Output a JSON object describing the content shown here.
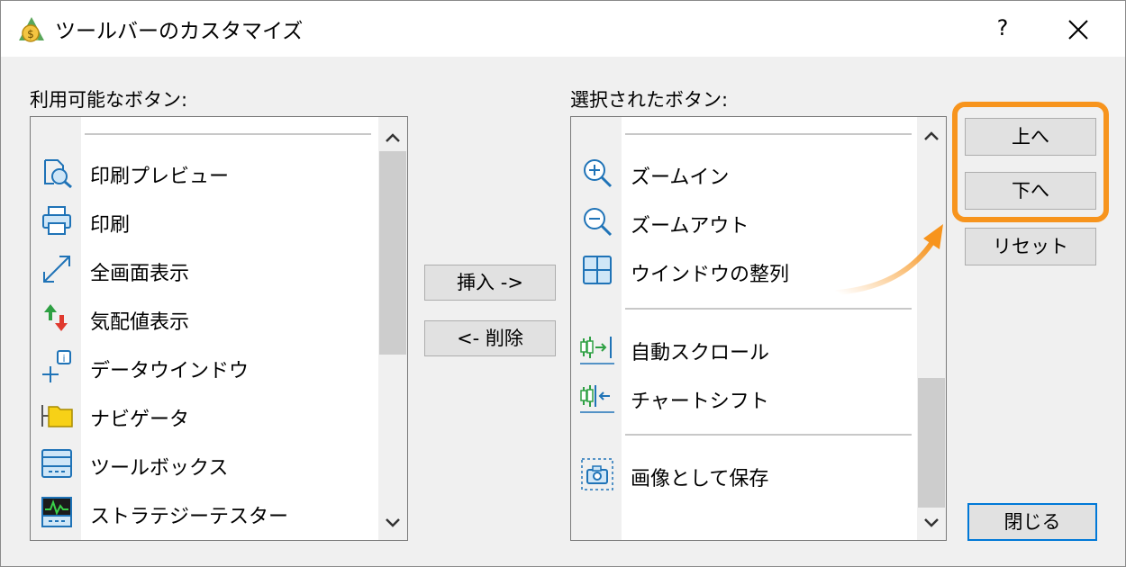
{
  "window": {
    "title": "ツールバーのカスタマイズ",
    "help_label": "?",
    "close_icon": "close-icon"
  },
  "available": {
    "label": "利用可能なボタン:",
    "items": [
      {
        "label": "印刷プレビュー",
        "icon": "print-preview-icon"
      },
      {
        "label": "印刷",
        "icon": "printer-icon"
      },
      {
        "label": "全画面表示",
        "icon": "fullscreen-icon"
      },
      {
        "label": "気配値表示",
        "icon": "market-watch-icon"
      },
      {
        "label": "データウインドウ",
        "icon": "data-window-icon"
      },
      {
        "label": "ナビゲータ",
        "icon": "navigator-icon"
      },
      {
        "label": "ツールボックス",
        "icon": "toolbox-icon"
      },
      {
        "label": "ストラテジーテスター",
        "icon": "strategy-tester-icon"
      }
    ]
  },
  "selected": {
    "label": "選択されたボタン:",
    "items": [
      {
        "label": "ズームイン",
        "icon": "zoom-in-icon"
      },
      {
        "label": "ズームアウト",
        "icon": "zoom-out-icon"
      },
      {
        "label": "ウインドウの整列",
        "icon": "tile-windows-icon"
      },
      {
        "label": "自動スクロール",
        "icon": "auto-scroll-icon"
      },
      {
        "label": "チャートシフト",
        "icon": "chart-shift-icon"
      },
      {
        "label": "画像として保存",
        "icon": "save-as-picture-icon"
      }
    ]
  },
  "buttons": {
    "insert": "挿入 ->",
    "delete": "<- 削除",
    "up": "上へ",
    "down": "下へ",
    "reset": "リセット",
    "close": "閉じる"
  },
  "colors": {
    "highlight": "#f7941d",
    "default_button_border": "#0078d7",
    "icon_blue": "#1f73b7"
  }
}
